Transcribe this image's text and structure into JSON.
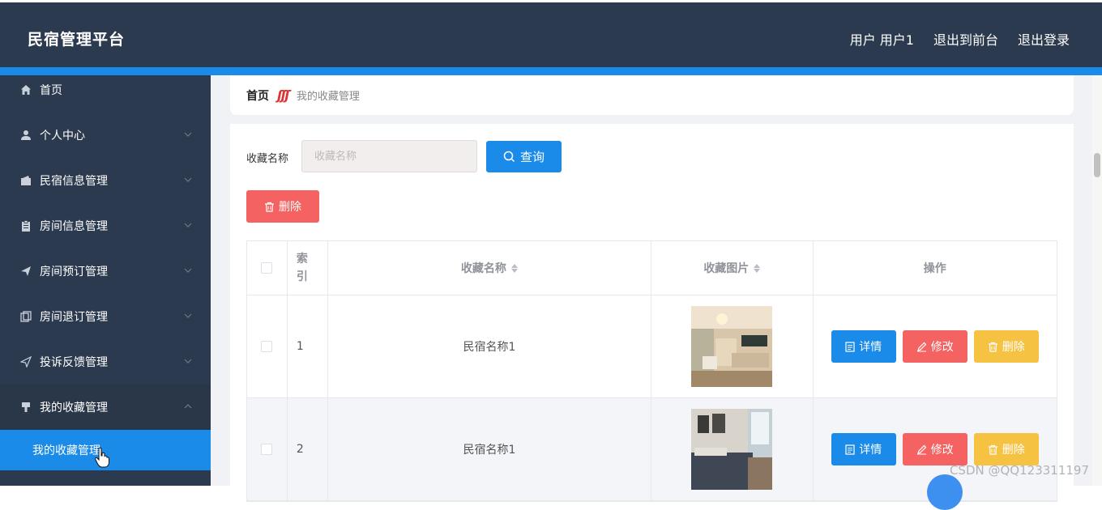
{
  "header": {
    "brand": "民宿管理平台",
    "user_label": "用户 用户1",
    "exit_front_label": "退出到前台",
    "logout_label": "退出登录"
  },
  "sidebar": {
    "items": [
      {
        "label": "首页",
        "icon": "home-icon"
      },
      {
        "label": "个人中心",
        "icon": "user-icon"
      },
      {
        "label": "民宿信息管理",
        "icon": "wallet-icon"
      },
      {
        "label": "房间信息管理",
        "icon": "clipboard-icon"
      },
      {
        "label": "房间预订管理",
        "icon": "send-icon"
      },
      {
        "label": "房间退订管理",
        "icon": "copy-icon"
      },
      {
        "label": "投诉反馈管理",
        "icon": "paper-plane-icon"
      },
      {
        "label": "我的收藏管理",
        "icon": "pin-icon"
      }
    ],
    "active_sub": "我的收藏管理"
  },
  "breadcrumb": {
    "home": "首页",
    "separator": "ʃʃʃ",
    "current": "我的收藏管理"
  },
  "search": {
    "label": "收藏名称",
    "placeholder": "收藏名称",
    "button": "查询"
  },
  "toolbar": {
    "delete_label": "删除"
  },
  "table": {
    "headers": {
      "index": "索引",
      "name": "收藏名称",
      "image": "收藏图片",
      "ops": "操作"
    },
    "rows": [
      {
        "index": "1",
        "name": "民宿名称1",
        "image": "living-room-photo"
      },
      {
        "index": "2",
        "name": "民宿名称1",
        "image": "bedroom-photo"
      }
    ],
    "op_labels": {
      "detail": "详情",
      "edit": "修改",
      "delete": "删除"
    }
  },
  "watermark": "CSDN @QQ123311197",
  "colors": {
    "header_bg": "#2c3a4f",
    "accent": "#1a8be8",
    "danger": "#f56262",
    "warning": "#f5c242"
  }
}
